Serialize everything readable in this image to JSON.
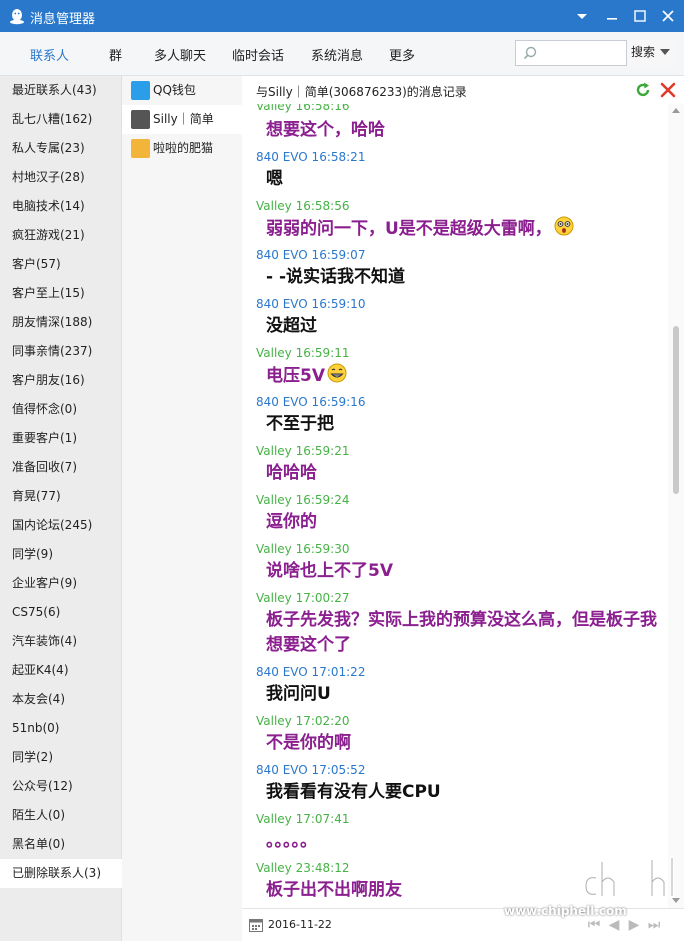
{
  "window": {
    "title": "消息管理器"
  },
  "nav": {
    "tabs": [
      "联系人",
      "群",
      "多人聊天",
      "临时会话",
      "系统消息",
      "更多"
    ],
    "active_tab": "联系人",
    "search_placeholder": "",
    "search_button": "搜索",
    "accent": "#2a78cc"
  },
  "groups": [
    "最近联系人(43)",
    "乱七八糟(162)",
    "私人专属(23)",
    "村地汉子(28)",
    "电脑技术(14)",
    "疯狂游戏(21)",
    "客户(57)",
    "客户至上(15)",
    "朋友情深(188)",
    "同事亲情(237)",
    "客户朋友(16)",
    "值得怀念(0)",
    "重要客户(1)",
    "准备回收(7)",
    "育晃(77)",
    "国内论坛(245)",
    "同学(9)",
    "企业客户(9)",
    "CS75(6)",
    "汽车装饰(4)",
    "起亚K4(4)",
    "本友会(4)",
    "51nb(0)",
    "同学(2)",
    "公众号(12)",
    "陌生人(0)",
    "黑名单(0)",
    "已删除联系人(3)"
  ],
  "active_group": "已删除联系人(3)",
  "contacts": [
    {
      "name": "QQ钱包",
      "avatar": "qq-wallet-avatar"
    },
    {
      "name": "Silly｜简单",
      "avatar": "silly-avatar"
    },
    {
      "name": "啦啦的肥猫",
      "avatar": "cat-avatar"
    }
  ],
  "active_contact": "Silly｜简单",
  "chat": {
    "header": "与Silly｜简单(306876233)的消息记录",
    "partial_top": "Valley 16:58:16",
    "messages": [
      {
        "sender": "Valley",
        "meta": "",
        "text": "想要这个，哈哈",
        "emoji": ""
      },
      {
        "sender": "840 EVO",
        "meta": "840 EVO 16:58:21",
        "text": "嗯",
        "emoji": ""
      },
      {
        "sender": "Valley",
        "meta": "Valley 16:58:56",
        "text": "弱弱的问一下，U是不是超级大雷啊，",
        "emoji": "shocked-emoji"
      },
      {
        "sender": "840 EVO",
        "meta": "840 EVO 16:59:07",
        "text": "- -说实话我不知道",
        "emoji": ""
      },
      {
        "sender": "840 EVO",
        "meta": "840 EVO 16:59:10",
        "text": "没超过",
        "emoji": ""
      },
      {
        "sender": "Valley",
        "meta": "Valley 16:59:11",
        "text": "电压5V",
        "emoji": "grin-emoji"
      },
      {
        "sender": "840 EVO",
        "meta": "840 EVO 16:59:16",
        "text": "不至于把",
        "emoji": ""
      },
      {
        "sender": "Valley",
        "meta": "Valley 16:59:21",
        "text": "哈哈哈",
        "emoji": ""
      },
      {
        "sender": "Valley",
        "meta": "Valley 16:59:24",
        "text": "逗你的",
        "emoji": ""
      },
      {
        "sender": "Valley",
        "meta": "Valley 16:59:30",
        "text": "说啥也上不了5V",
        "emoji": ""
      },
      {
        "sender": "Valley",
        "meta": "Valley 17:00:27",
        "text": "板子先发我？实际上我的预算没这么高，但是板子我想要这个了",
        "emoji": ""
      },
      {
        "sender": "840 EVO",
        "meta": "840 EVO 17:01:22",
        "text": "我问问U",
        "emoji": ""
      },
      {
        "sender": "Valley",
        "meta": "Valley 17:02:20",
        "text": "不是你的啊",
        "emoji": ""
      },
      {
        "sender": "840 EVO",
        "meta": "840 EVO 17:05:52",
        "text": "我看看有没有人要CPU",
        "emoji": ""
      },
      {
        "sender": "Valley",
        "meta": "Valley 17:07:41",
        "text": "。。。。。",
        "emoji": ""
      },
      {
        "sender": "Valley",
        "meta": "Valley 23:48:12",
        "text": "板子出不出啊朋友",
        "emoji": ""
      }
    ],
    "colors": {
      "valley_meta": "#46b246",
      "evo_meta": "#2a78cc",
      "valley_text": "#8b1f8f",
      "evo_text": "#111111"
    }
  },
  "footer": {
    "date": "2016-11-22"
  },
  "watermark": {
    "url": "www.chiphell.com"
  }
}
